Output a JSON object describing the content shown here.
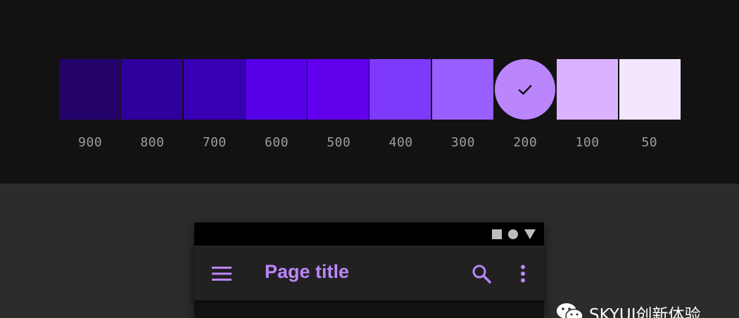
{
  "palette": {
    "swatches": [
      {
        "label": "900",
        "color": "#23036a",
        "selected": false
      },
      {
        "label": "800",
        "color": "#30009c",
        "selected": false
      },
      {
        "label": "700",
        "color": "#3700b3",
        "selected": false
      },
      {
        "label": "600",
        "color": "#5600e8",
        "selected": false
      },
      {
        "label": "500",
        "color": "#6200ee",
        "selected": false
      },
      {
        "label": "400",
        "color": "#7f39fb",
        "selected": false
      },
      {
        "label": "300",
        "color": "#985eff",
        "selected": false
      },
      {
        "label": "200",
        "color": "#bb86fc",
        "selected": true
      },
      {
        "label": "100",
        "color": "#dbb2ff",
        "selected": false
      },
      {
        "label": "50",
        "color": "#f2e7fe",
        "selected": false
      }
    ],
    "check_icon": "check-icon"
  },
  "phone": {
    "status_icons": [
      "square-icon",
      "circle-icon",
      "triangle-icon"
    ],
    "app_bar": {
      "menu_icon": "menu-icon",
      "title": "Page title",
      "search_icon": "search-icon",
      "more_icon": "more-vert-icon",
      "accent_color": "#bb86fc"
    }
  },
  "watermark": {
    "icon": "wechat-icon",
    "text": "SKYUI创新体验"
  }
}
